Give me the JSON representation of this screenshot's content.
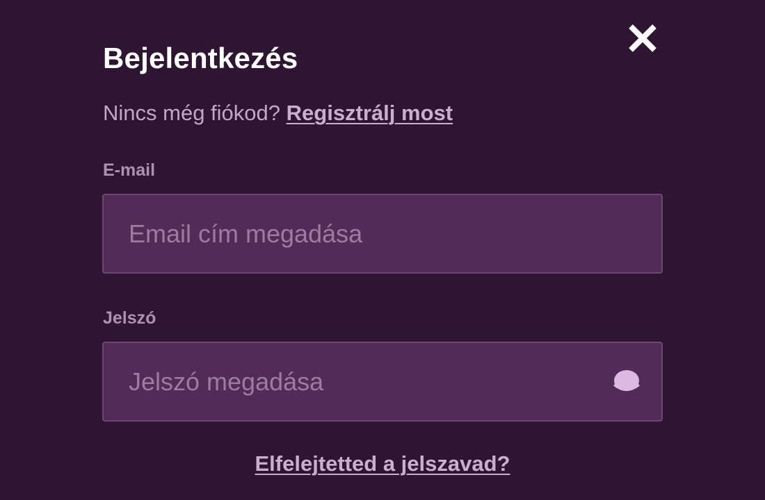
{
  "modal": {
    "title": "Bejelentkezés",
    "close_icon": "close-icon"
  },
  "signup": {
    "prompt": "Nincs még fiókod?",
    "link_label": "Regisztrálj most"
  },
  "email": {
    "label": "E-mail",
    "placeholder": "Email cím megadása",
    "value": ""
  },
  "password": {
    "label": "Jelszó",
    "placeholder": "Jelszó megadása",
    "value": "",
    "toggle_icon": "eye-icon"
  },
  "forgot": {
    "link_label": "Elfelejtetted a jelszavad?"
  },
  "colors": {
    "background": "#2e1532",
    "input_background": "#532b57",
    "input_border": "#6e4673",
    "title": "#ffffff",
    "text_muted": "#c1a9c4",
    "link": "#c9b1cc",
    "eye_icon": "#dcb9e0"
  }
}
